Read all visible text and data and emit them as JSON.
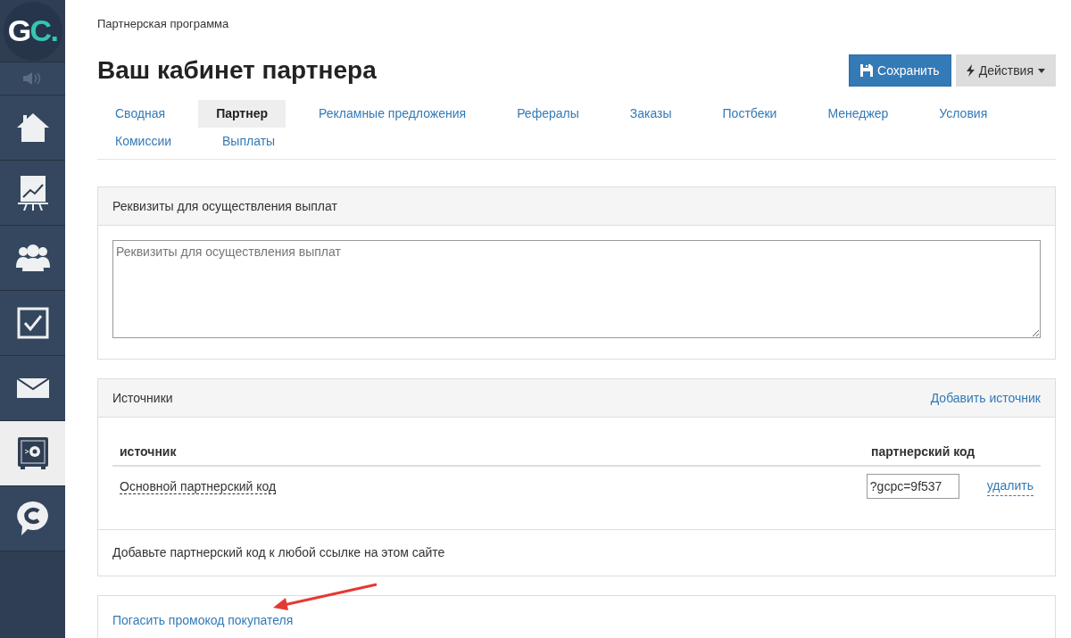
{
  "sidebar": {
    "logo": {
      "text": "GC",
      "dot": "."
    },
    "items": [
      {
        "kind": "speaker",
        "selected": false
      },
      {
        "kind": "home",
        "selected": false
      },
      {
        "kind": "chart",
        "selected": false
      },
      {
        "kind": "users",
        "selected": false
      },
      {
        "kind": "tasks",
        "selected": false
      },
      {
        "kind": "mail",
        "selected": false
      },
      {
        "kind": "safe",
        "selected": true
      },
      {
        "kind": "chat",
        "selected": false
      }
    ]
  },
  "breadcrumb": "Партнерская программа",
  "title": "Ваш кабинет партнера",
  "buttons": [
    {
      "kind": "save",
      "label": "Сохранить"
    },
    {
      "kind": "actions",
      "label": "Действия"
    }
  ],
  "tabs": [
    {
      "label": "Сводная",
      "selected": false
    },
    {
      "label": "Партнер",
      "selected": true
    },
    {
      "label": "Рекламные предложения",
      "selected": false
    },
    {
      "label": "Рефералы",
      "selected": false
    },
    {
      "label": "Заказы",
      "selected": false
    },
    {
      "label": "Постбеки",
      "selected": false
    },
    {
      "label": "Менеджер",
      "selected": false
    },
    {
      "label": "Условия",
      "selected": false
    },
    {
      "label": "Комиссии",
      "selected": false
    },
    {
      "label": "Выплаты",
      "selected": false
    }
  ],
  "payment_panel": {
    "title": "Реквизиты для осуществления выплат",
    "field": {
      "placeholder": "Реквизиты для осуществления выплат"
    }
  },
  "sources_panel": {
    "title": "Источники",
    "add_link": "Добавить источник",
    "table": {
      "columns": [
        "источник",
        "партнерский код"
      ],
      "rows": [
        {
          "source": "Основной партнерский код",
          "code": "?gcpc=9f537",
          "action": "удалить"
        }
      ]
    },
    "footer": "Добавьте партнерский код к любой ссылке на этом сайте"
  },
  "promo_panel": {
    "link": "Погасить промокод покупателя"
  }
}
